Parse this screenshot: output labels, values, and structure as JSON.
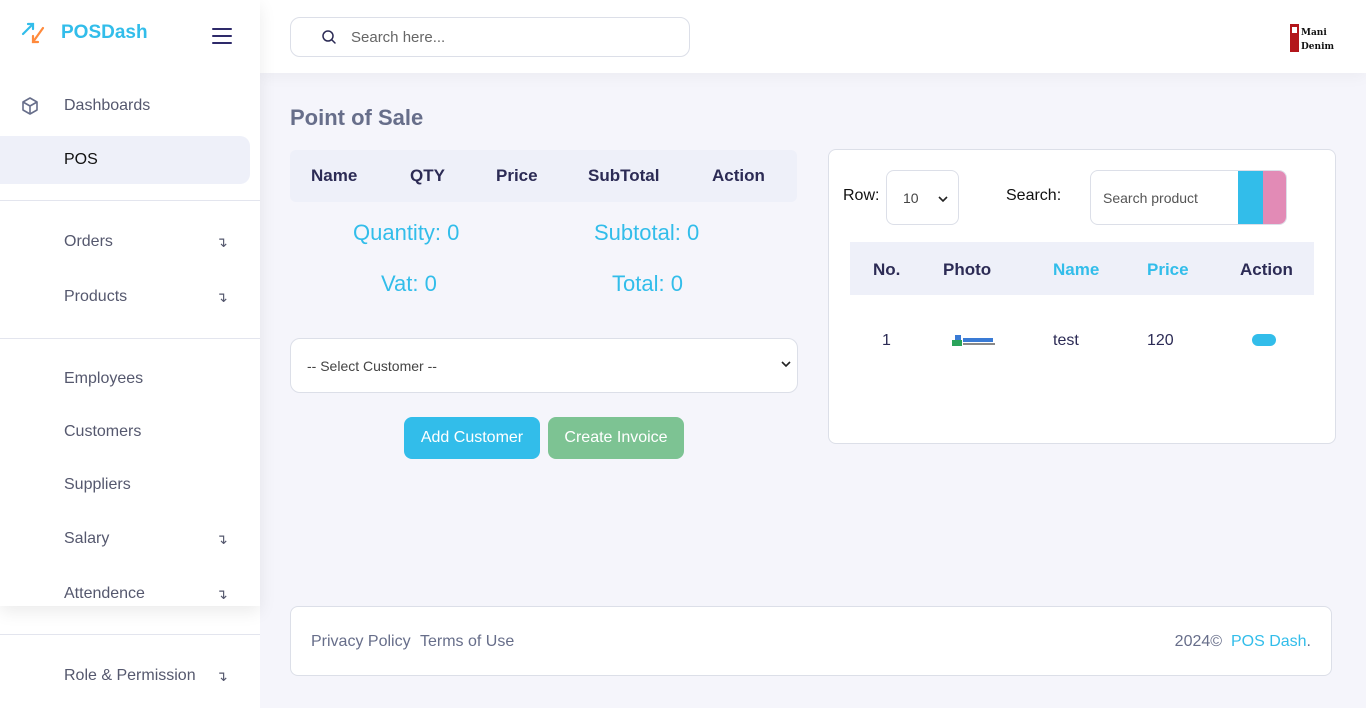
{
  "brand": {
    "name": "POSDash"
  },
  "topbar": {
    "search_placeholder": "Search here...",
    "logo_text_top": "Mani",
    "logo_text_bottom": "Denim"
  },
  "sidebar": {
    "items": [
      {
        "label": "Dashboards",
        "icon": "cube-icon",
        "has_arrow": false
      },
      {
        "label": "POS",
        "active": true,
        "has_arrow": false
      },
      {
        "label": "Orders",
        "has_arrow": true
      },
      {
        "label": "Products",
        "has_arrow": true
      },
      {
        "label": "Employees",
        "has_arrow": false
      },
      {
        "label": "Customers",
        "has_arrow": false
      },
      {
        "label": "Suppliers",
        "has_arrow": false
      },
      {
        "label": "Salary",
        "has_arrow": true
      },
      {
        "label": "Attendence",
        "has_arrow": true
      },
      {
        "label": "Role & Permission",
        "has_arrow": true
      }
    ],
    "arrow_glyph": "↴"
  },
  "page": {
    "title": "Point of Sale"
  },
  "cart": {
    "columns": [
      "Name",
      "QTY",
      "Price",
      "SubTotal",
      "Action"
    ],
    "quantity": "Quantity: 0",
    "subtotal": "Subtotal: 0",
    "vat": "Vat: 0",
    "total": "Total: 0",
    "customer_select": "-- Select Customer --",
    "add_customer": "Add Customer",
    "create_invoice": "Create Invoice"
  },
  "products": {
    "row_label": "Row:",
    "row_value": "10",
    "search_label": "Search:",
    "search_placeholder": "Search product",
    "columns": [
      "No.",
      "Photo",
      "Name",
      "Price",
      "Action"
    ],
    "rows": [
      {
        "no": "1",
        "name": "test",
        "price": "120"
      }
    ]
  },
  "footer": {
    "privacy": "Privacy Policy",
    "terms": "Terms of Use",
    "copyright": "2024©",
    "brand_link": "POS Dash",
    "period": "."
  },
  "colors": {
    "accent": "#32bdea",
    "green": "#7dc393",
    "pink": "#e28bb6",
    "text": "#676e8a",
    "dark": "#2c2b55"
  }
}
